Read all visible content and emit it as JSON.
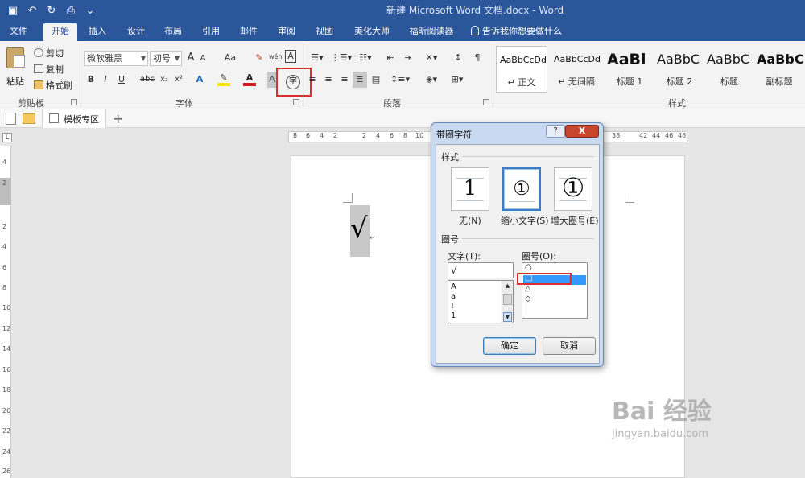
{
  "window": {
    "title": "新建 Microsoft Word 文档.docx  -  Word",
    "qat_icons": [
      "save-icon",
      "undo-icon",
      "redo-icon",
      "print-preview-icon",
      "customize-icon"
    ]
  },
  "tabs": [
    "文件",
    "开始",
    "插入",
    "设计",
    "布局",
    "引用",
    "邮件",
    "审阅",
    "视图",
    "美化大师",
    "福昕阅读器"
  ],
  "active_tab": "开始",
  "tell_me": "告诉我你想要做什么",
  "ribbon": {
    "clipboard": {
      "paste": "粘贴",
      "cut": "剪切",
      "copy": "复制",
      "format_painter": "格式刷",
      "group_label": "剪贴板"
    },
    "font": {
      "font_name": "微软雅黑",
      "font_size": "初号",
      "grow": "A",
      "shrink": "A",
      "case": "Aa",
      "bold": "B",
      "italic": "I",
      "underline": "U",
      "strike": "abc",
      "subscript": "x₂",
      "superscript": "x²",
      "enclosed_char_glyph": "字",
      "group_label": "字体"
    },
    "paragraph": {
      "group_label": "段落"
    },
    "styles": {
      "items": [
        {
          "sample": "AaBbCcDd",
          "name": "↵ 正文"
        },
        {
          "sample": "AaBbCcDd",
          "name": "↵ 无间隔"
        },
        {
          "sample": "AaBl",
          "name": "标题 1"
        },
        {
          "sample": "AaBbC",
          "name": "标题 2"
        },
        {
          "sample": "AaBbC",
          "name": "标题"
        },
        {
          "sample": "AaBbC",
          "name": "副标题"
        }
      ],
      "group_label": "样式"
    }
  },
  "doc_tabs": {
    "template_tab": "模板专区"
  },
  "ruler": {
    "h_ticks": [
      "8",
      "6",
      "4",
      "2",
      "2",
      "4",
      "6",
      "8",
      "10",
      "38",
      "42",
      "44",
      "46",
      "48"
    ],
    "v_ticks": [
      "4",
      "2",
      "2",
      "4",
      "6",
      "8",
      "10",
      "12",
      "14",
      "16",
      "18",
      "20",
      "22",
      "24",
      "26"
    ]
  },
  "document": {
    "selected_text": "√"
  },
  "dialog": {
    "title": "带圈字符",
    "help": "?",
    "close": "X",
    "style_section": "样式",
    "styles": [
      {
        "glyph": "1",
        "label": "无(N)"
      },
      {
        "glyph": "①",
        "label": "缩小文字(S)"
      },
      {
        "glyph": "①",
        "label": "增大圈号(E)"
      }
    ],
    "enclosure_section": "圈号",
    "text_label": "文字(T):",
    "text_value": "√",
    "text_list": [
      "A",
      "a",
      "!",
      "1"
    ],
    "enclosure_label": "圈号(O):",
    "enclosure_list": [
      "○",
      "□",
      "△",
      "◇"
    ],
    "ok": "确定",
    "cancel": "取消"
  },
  "watermark": {
    "main": "Bai 经验",
    "sub": "jingyan.baidu.com"
  }
}
